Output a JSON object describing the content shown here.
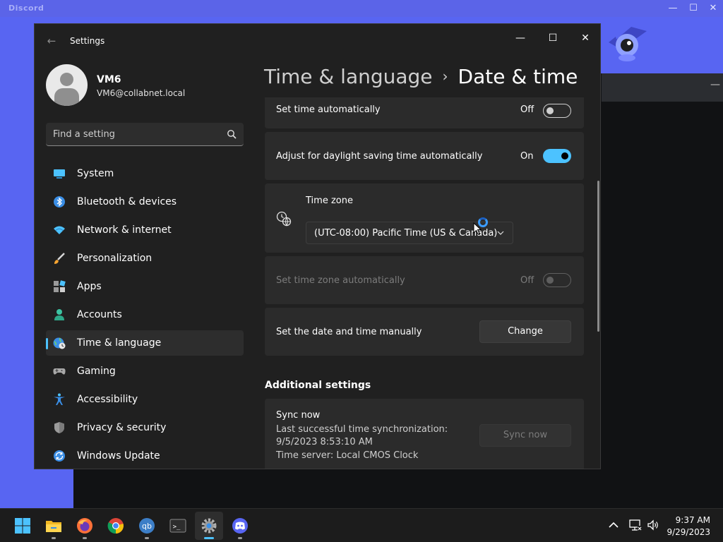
{
  "discord": {
    "title": "Discord",
    "minimize_glyph": "—",
    "maximize_glyph": "☐",
    "close_glyph": "✕",
    "inner_min_glyph": "—"
  },
  "window": {
    "title": "Settings",
    "back_glyph": "←",
    "minimize_glyph": "—",
    "maximize_glyph": "☐",
    "close_glyph": "✕"
  },
  "profile": {
    "name": "VM6",
    "email": "VM6@collabnet.local"
  },
  "search": {
    "placeholder": "Find a setting"
  },
  "nav": [
    {
      "label": "System",
      "icon": "system-icon"
    },
    {
      "label": "Bluetooth & devices",
      "icon": "bluetooth-icon"
    },
    {
      "label": "Network & internet",
      "icon": "wifi-icon"
    },
    {
      "label": "Personalization",
      "icon": "brush-icon"
    },
    {
      "label": "Apps",
      "icon": "apps-icon"
    },
    {
      "label": "Accounts",
      "icon": "person-icon"
    },
    {
      "label": "Time & language",
      "icon": "globe-clock-icon",
      "active": true
    },
    {
      "label": "Gaming",
      "icon": "gamepad-icon"
    },
    {
      "label": "Accessibility",
      "icon": "accessibility-icon"
    },
    {
      "label": "Privacy & security",
      "icon": "shield-icon"
    },
    {
      "label": "Windows Update",
      "icon": "update-icon"
    }
  ],
  "breadcrumb": {
    "parent": "Time & language",
    "separator": "›",
    "current": "Date & time"
  },
  "settings": {
    "set_time_auto": {
      "label": "Set time automatically",
      "state": "Off"
    },
    "daylight": {
      "label": "Adjust for daylight saving time automatically",
      "state": "On"
    },
    "timezone": {
      "label": "Time zone",
      "value": "(UTC-08:00) Pacific Time (US & Canada)"
    },
    "set_tz_auto": {
      "label": "Set time zone automatically",
      "state": "Off"
    },
    "manual": {
      "label": "Set the date and time manually",
      "button": "Change"
    }
  },
  "additional": {
    "title": "Additional settings",
    "sync": {
      "title": "Sync now",
      "line1": "Last successful time synchronization:",
      "line2": "9/5/2023 8:53:10 AM",
      "line3": "Time server: Local CMOS Clock",
      "button": "Sync now"
    }
  },
  "taskbar": {
    "apps": [
      "windows-start-icon",
      "file-explorer-icon",
      "firefox-icon",
      "chrome-icon",
      "qbittorrent-icon",
      "terminal-icon",
      "settings-gear-icon",
      "discord-icon"
    ],
    "qb_text": "qb",
    "terminal_text": ">_",
    "time": "9:37 AM",
    "date": "9/29/2023"
  },
  "colors": {
    "accent": "#4cc2ff",
    "discord": "#5865f2",
    "window_bg": "#202020",
    "card_bg": "#2b2b2b"
  }
}
